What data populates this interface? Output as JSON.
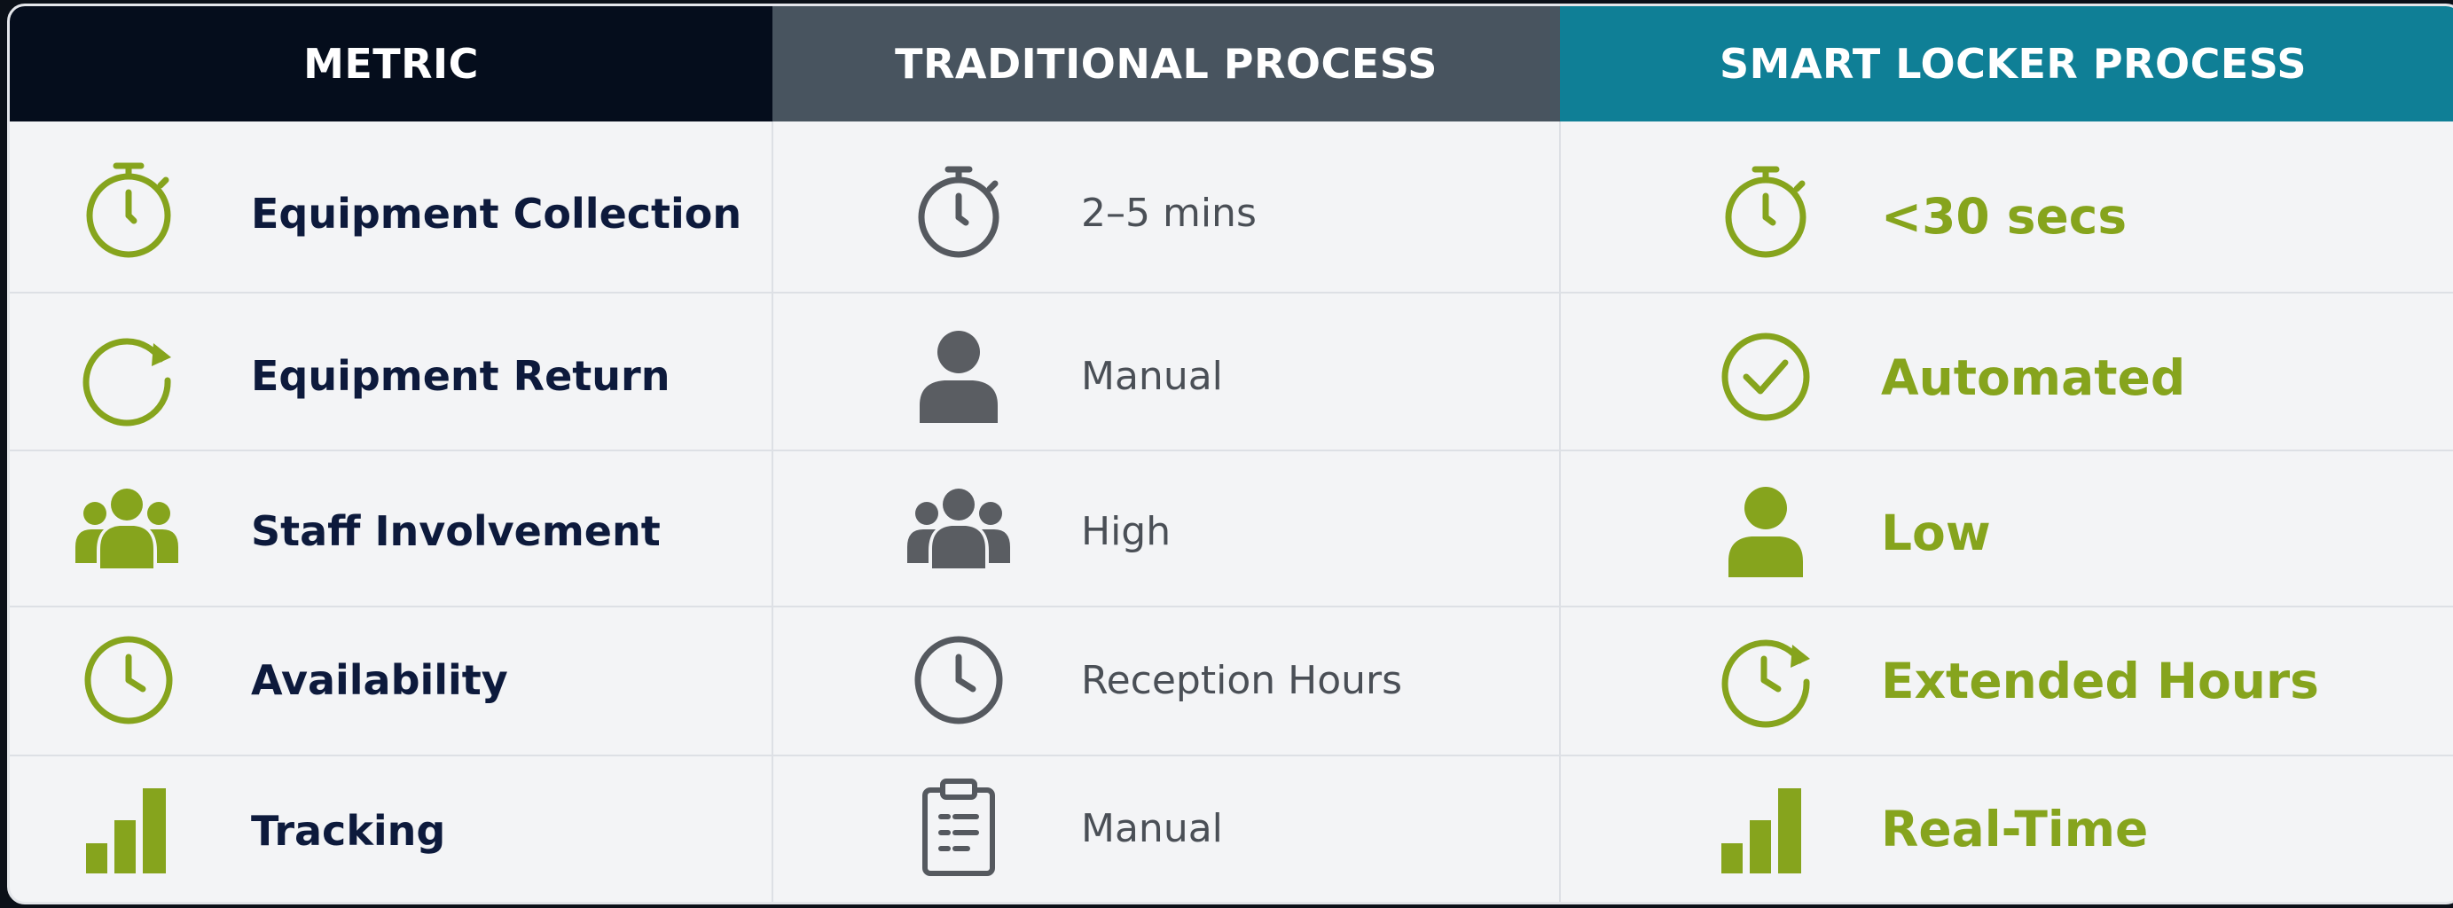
{
  "headers": {
    "metric": "METRIC",
    "traditional": "TRADITIONAL PROCESS",
    "smart": "SMART LOCKER PROCESS"
  },
  "rows": [
    {
      "metric": "Equipment Collection",
      "metric_icon": "stopwatch-icon",
      "traditional": "2–5 mins",
      "traditional_icon": "stopwatch-icon",
      "smart": "<30 secs",
      "smart_icon": "stopwatch-icon"
    },
    {
      "metric": "Equipment Return",
      "metric_icon": "refresh-icon",
      "traditional": "Manual",
      "traditional_icon": "person-icon",
      "smart": "Automated",
      "smart_icon": "check-circle-icon"
    },
    {
      "metric": "Staff Involvement",
      "metric_icon": "group-icon",
      "traditional": "High",
      "traditional_icon": "group-icon",
      "smart": "Low",
      "smart_icon": "person-icon"
    },
    {
      "metric": "Availability",
      "metric_icon": "clock-icon",
      "traditional": "Reception Hours",
      "traditional_icon": "clock-icon",
      "smart": "Extended Hours",
      "smart_icon": "clock-refresh-icon"
    },
    {
      "metric": "Tracking",
      "metric_icon": "bar-chart-icon",
      "traditional": "Manual",
      "traditional_icon": "clipboard-icon",
      "smart": "Real-Time",
      "smart_icon": "bar-chart-icon"
    }
  ],
  "colors": {
    "header_metric": "#050d1c",
    "header_traditional": "#48545f",
    "header_smart": "#0f7f96",
    "accent_green": "#86a41d",
    "icon_gray": "#5a5d62",
    "metric_text": "#0d1a3c"
  }
}
